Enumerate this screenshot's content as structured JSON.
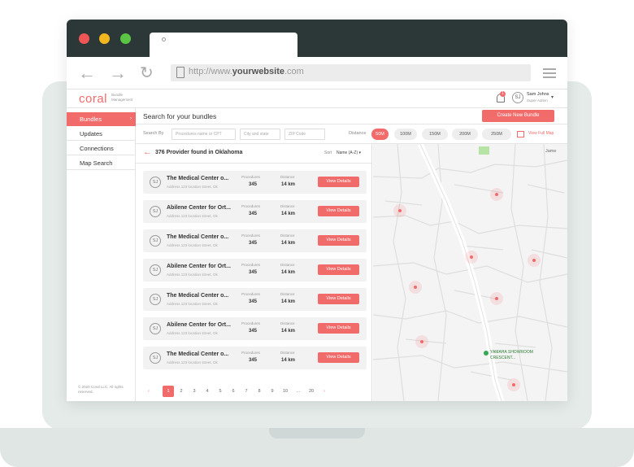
{
  "browser": {
    "url_prefix": "http://www.",
    "url_domain": "yourwebsite",
    "url_suffix": ".com"
  },
  "app": {
    "logo": "coral",
    "logo_sub": "Bundle Management",
    "notification_count": "1",
    "user": {
      "initials": "SJ",
      "name": "Sam Johns",
      "role": "Super Admin"
    }
  },
  "sidebar": {
    "items": [
      {
        "label": "Bundles",
        "active": true
      },
      {
        "label": "Updates",
        "active": false
      },
      {
        "label": "Connections",
        "active": false
      },
      {
        "label": "Map Search",
        "active": false
      }
    ],
    "copyright": "© 2020 Coral LLC. All rights reserved."
  },
  "header": {
    "title": "Search for your bundles",
    "create_button": "Create New Bundle"
  },
  "filters": {
    "search_by_label": "Search By",
    "procedure_placeholder": "Procedures name or CPT",
    "city_placeholder": "City and state",
    "zip_placeholder": "ZIP Code",
    "distance_label": "Distance",
    "distance_options": [
      "50M",
      "100M",
      "150M",
      "200M",
      "250M"
    ],
    "distance_selected": "50M",
    "view_map_label": "View Full Map"
  },
  "list": {
    "title": "376 Provider found in Oklahoma",
    "sort_label": "Sort",
    "sort_value": "Name (A-Z)",
    "procedures_label": "Procedures",
    "distance_label": "Distance",
    "view_button": "View Details",
    "providers": [
      {
        "initials": "SJ",
        "name": "The Medical Center o...",
        "address": "Address 123 location street, Ok",
        "procedures": "345",
        "distance": "14 km"
      },
      {
        "initials": "SJ",
        "name": "Abilene Center for Ort...",
        "address": "Address 123 location street, Ok",
        "procedures": "345",
        "distance": "14 km"
      },
      {
        "initials": "SJ",
        "name": "The Medical Center o...",
        "address": "Address 123 location street, Ok",
        "procedures": "345",
        "distance": "14 km"
      },
      {
        "initials": "SJ",
        "name": "Abilene Center for Ort...",
        "address": "Address 123 location street, Ok",
        "procedures": "345",
        "distance": "14 km"
      },
      {
        "initials": "SJ",
        "name": "The Medical Center o...",
        "address": "Address 123 location street, Ok",
        "procedures": "345",
        "distance": "14 km"
      },
      {
        "initials": "SJ",
        "name": "Abilene Center for Ort...",
        "address": "Address 123 location street, Ok",
        "procedures": "345",
        "distance": "14 km"
      },
      {
        "initials": "SJ",
        "name": "The Medical Center o...",
        "address": "Address 123 location street, Ok",
        "procedures": "345",
        "distance": "14 km"
      }
    ]
  },
  "pagination": {
    "prev": "‹",
    "next": "›",
    "pages": [
      "1",
      "2",
      "3",
      "4",
      "5",
      "6",
      "7",
      "8",
      "9",
      "10",
      "...",
      "20"
    ],
    "current": "1"
  },
  "map": {
    "place_label_1": "YAMAHA SHOWROOM",
    "place_label_2": "CRESCENT...",
    "corner_label": "Jame",
    "accent": "#f26b6b"
  },
  "colors": {
    "accent": "#f26b6b",
    "titlebar": "#2c3838",
    "laptop": "#e4ebe9"
  }
}
